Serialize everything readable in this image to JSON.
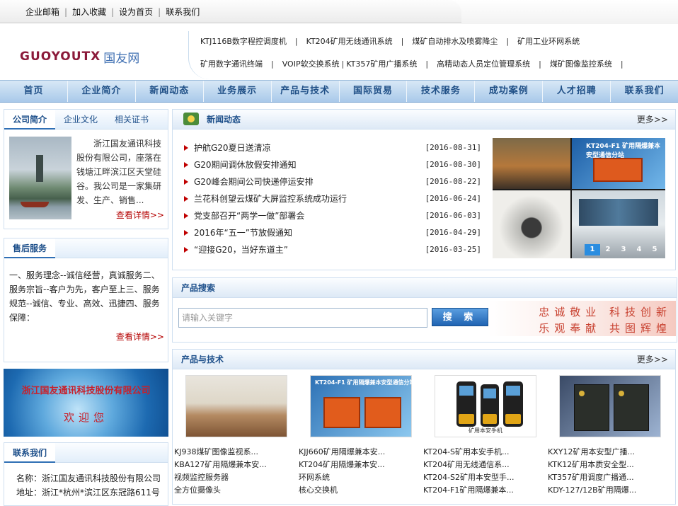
{
  "top_links": [
    "企业邮箱",
    "加入收藏",
    "设为首页",
    "联系我们"
  ],
  "logo": {
    "mark": "GUOYOUTX",
    "name": "国友网"
  },
  "product_links": {
    "row1": [
      "KTJ116B数字程控调度机",
      "KT204矿用无线通讯系统",
      "煤矿自动排水及喷雾降尘",
      "矿用工业环网系统"
    ],
    "row2": [
      "矿用数字通讯终端",
      "VOIP软交换系统",
      "KT357矿用广播系统",
      "高精动态人员定位管理系统",
      "煤矿图像监控系统"
    ]
  },
  "nav": [
    "首页",
    "企业简介",
    "新闻动态",
    "业务展示",
    "产品与技术",
    "国际贸易",
    "技术服务",
    "成功案例",
    "人才招聘",
    "联系我们"
  ],
  "intro": {
    "tabs": [
      "公司简介",
      "企业文化",
      "相关证书"
    ],
    "text": "浙江国友通讯科技股份有限公司，座落在钱塘江畔滨江区天堂硅谷。我公司是一家集研发、生产、销售...",
    "more": "查看详情>>"
  },
  "service": {
    "title": "售后服务",
    "text": "一、服务理念--诚信经营，真诚服务二、服务宗旨--客户为先，客户至上三、服务规范--诚信、专业、高效、迅捷四、服务保障：",
    "more": "查看详情>>"
  },
  "banner": {
    "company": "浙江国友通讯科技股份有限公司",
    "welcome": "欢迎您"
  },
  "contact": {
    "title": "联系我们",
    "name": "名称：浙江国友通讯科技股份有限公司",
    "address": "地址：浙江*杭州*滨江区东冠路611号"
  },
  "news": {
    "title": "新闻动态",
    "more": "更多>>",
    "items": [
      {
        "title": "护航G20夏日送清凉",
        "date": "[2016-08-31]"
      },
      {
        "title": "G20期间调休放假安排通知",
        "date": "[2016-08-30]"
      },
      {
        "title": "G20峰会期间公司快递停运安排",
        "date": "[2016-08-22]"
      },
      {
        "title": "兰花科创望云煤矿大屏监控系统成功运行",
        "date": "[2016-06-24]"
      },
      {
        "title": "党支部召开“两学一做”部署会",
        "date": "[2016-06-03]"
      },
      {
        "title": "2016年“五一”节放假通知",
        "date": "[2016-04-29]"
      },
      {
        "title": "“迎接G20，当好东道主”",
        "date": "[2016-03-25]"
      }
    ],
    "photo_caption": "KT204-F1 矿用隔爆兼本安型通信分站",
    "slides": [
      "1",
      "2",
      "3",
      "4",
      "5"
    ]
  },
  "search": {
    "title": "产品搜索",
    "placeholder": "请输入关键字",
    "button": "搜 索",
    "slogan1": "忠诚敬业  科技创新",
    "slogan2": "乐观奉献  共图辉煌"
  },
  "products": {
    "title": "产品与技术",
    "more": "更多>>",
    "cols": [
      {
        "img_text": "",
        "names": [
          "KJ938煤矿图像监视系...",
          "KBA127矿用隔爆兼本安...",
          "视频监控服务器",
          "全方位摄像头"
        ]
      },
      {
        "img_text": "KT204-F1 矿用隔爆兼本安型通信分站",
        "names": [
          "KJJ660矿用隔爆兼本安...",
          "KT204矿用隔爆兼本安...",
          "环网系统",
          "核心交换机"
        ]
      },
      {
        "img_text": "矿用本安手机",
        "names": [
          "KT204-S矿用本安手机...",
          "KT204矿用无线通信系...",
          "KT204-S2矿用本安型手...",
          "KT204-F1矿用隔爆兼本..."
        ]
      },
      {
        "img_text": "",
        "names": [
          "KXY12矿用本安型广播...",
          "KTK12矿用本质安全型...",
          "KT357矿用调度广播通...",
          "KDY-127/12B矿用隔爆..."
        ]
      }
    ]
  }
}
